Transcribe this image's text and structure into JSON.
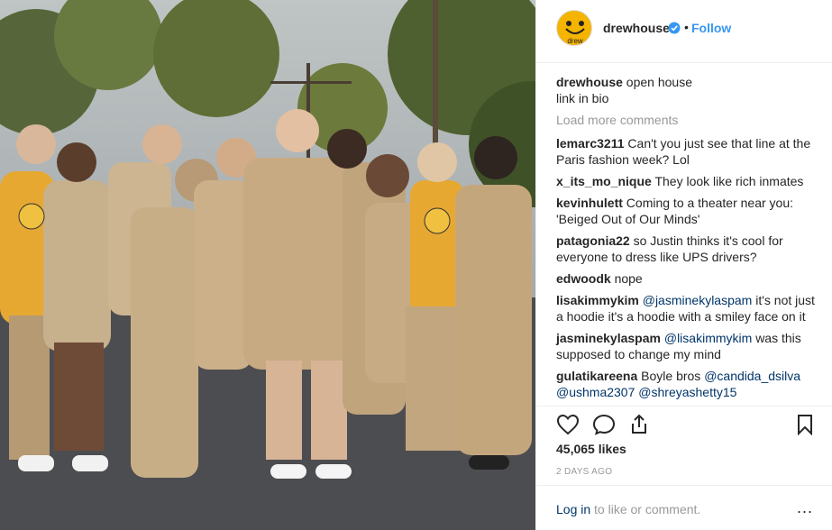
{
  "post": {
    "photo_alt": "Group of people in beige clothing",
    "header": {
      "username": "drewhouse",
      "follow_label": "Follow",
      "dot": "•",
      "avatar_text": "drew"
    },
    "caption": {
      "username": "drewhouse",
      "line1": "open house",
      "line2": "link in bio"
    },
    "load_more_label": "Load more comments",
    "comments": [
      {
        "user": "lemarc3211",
        "text": "Can't you just see that line at the Paris fashion week? Lol"
      },
      {
        "user": "x_its_mo_nique",
        "text": "They look like rich inmates"
      },
      {
        "user": "kevinhulett",
        "text": "Coming to a theater near you: 'Beiged Out of Our Minds'"
      },
      {
        "user": "patagonia22",
        "text": "so Justin thinks it's cool for everyone to dress like UPS drivers?"
      },
      {
        "user": "edwoodk",
        "text": "nope"
      },
      {
        "user": "lisakimmykim",
        "mention": "@jasminekylaspam",
        "text": "it's not just a hoodie it's a hoodie with a smiley face on it"
      },
      {
        "user": "jasminekylaspam",
        "mention": "@lisakimmykim",
        "text": "was this supposed to change my mind"
      },
      {
        "user": "gulatikareena",
        "text": "Boyle bros",
        "mention1": "@candida_dsilva",
        "mention2": "@ushma2307",
        "mention3": "@shreyashetty15"
      }
    ],
    "likes": "45,065 likes",
    "time": "2 DAYS AGO",
    "footer": {
      "login_label": "Log in",
      "login_rest": "to like or comment.",
      "more_label": "..."
    }
  },
  "icons": {
    "verified": "verified-badge-icon",
    "like": "heart-icon",
    "comment": "comment-bubble-icon",
    "share": "share-icon",
    "save": "bookmark-icon",
    "more": "more-options-icon"
  },
  "colors": {
    "accent": "#3897f0",
    "mention": "#003569",
    "muted": "#999999",
    "avatar_bg": "#f4b400"
  }
}
